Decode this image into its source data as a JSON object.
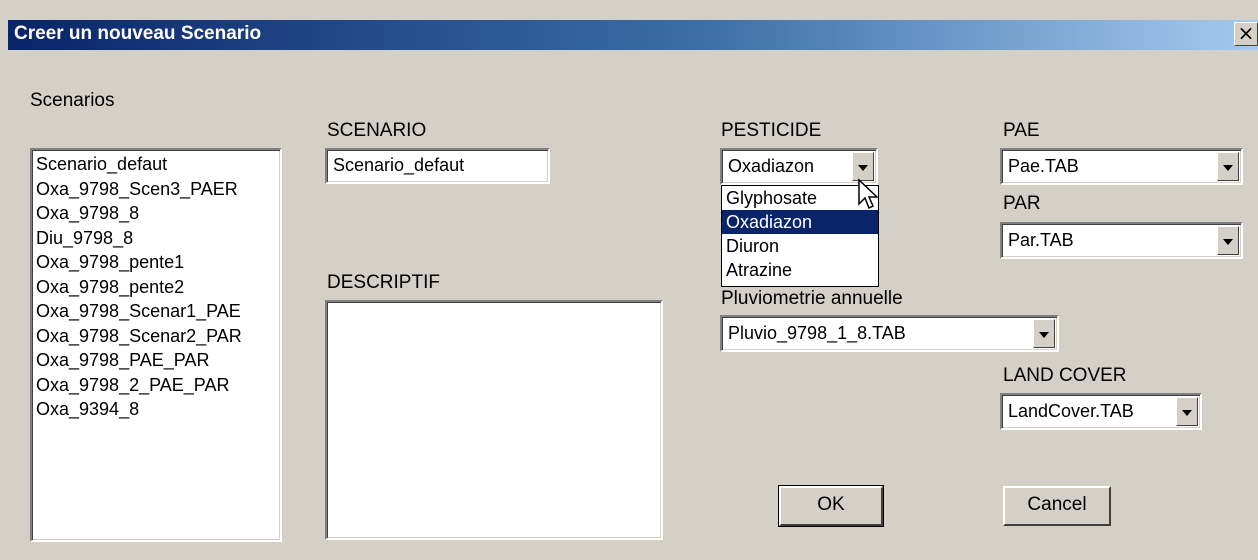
{
  "window": {
    "title": "Creer un nouveau Scenario",
    "close_glyph": "×"
  },
  "scenarios": {
    "label": "Scenarios",
    "items": [
      "Scenario_defaut",
      "Oxa_9798_Scen3_PAER",
      "Oxa_9798_8",
      "Diu_9798_8",
      "Oxa_9798_pente1",
      "Oxa_9798_pente2",
      "Oxa_9798_Scenar1_PAE",
      "Oxa_9798_Scenar2_PAR",
      "Oxa_9798_PAE_PAR",
      "Oxa_9798_2_PAE_PAR",
      "Oxa_9394_8"
    ]
  },
  "scenario": {
    "label": "SCENARIO",
    "value": "Scenario_defaut"
  },
  "descriptif": {
    "label": "DESCRIPTIF",
    "value": ""
  },
  "pesticide": {
    "label": "PESTICIDE",
    "value": "Oxadiazon",
    "options": [
      "Glyphosate",
      "Oxadiazon",
      "Diuron",
      "Atrazine"
    ],
    "selected_index": 1
  },
  "pae": {
    "label": "PAE",
    "value": "Pae.TAB"
  },
  "par": {
    "label": "PAR",
    "value": "Par.TAB"
  },
  "pluvio": {
    "label": "Pluviometrie annuelle",
    "value": "Pluvio_9798_1_8.TAB"
  },
  "landcover": {
    "label": "LAND COVER",
    "value": "LandCover.TAB"
  },
  "buttons": {
    "ok": "OK",
    "cancel": "Cancel"
  },
  "colors": {
    "face": "#d4d0c8",
    "title_start": "#0a246a",
    "title_end": "#a6caf0",
    "highlight": "#0a246a"
  },
  "icons": {
    "close": "close-icon",
    "dropdown": "chevron-down-icon",
    "pointer": "mouse-pointer-icon"
  }
}
